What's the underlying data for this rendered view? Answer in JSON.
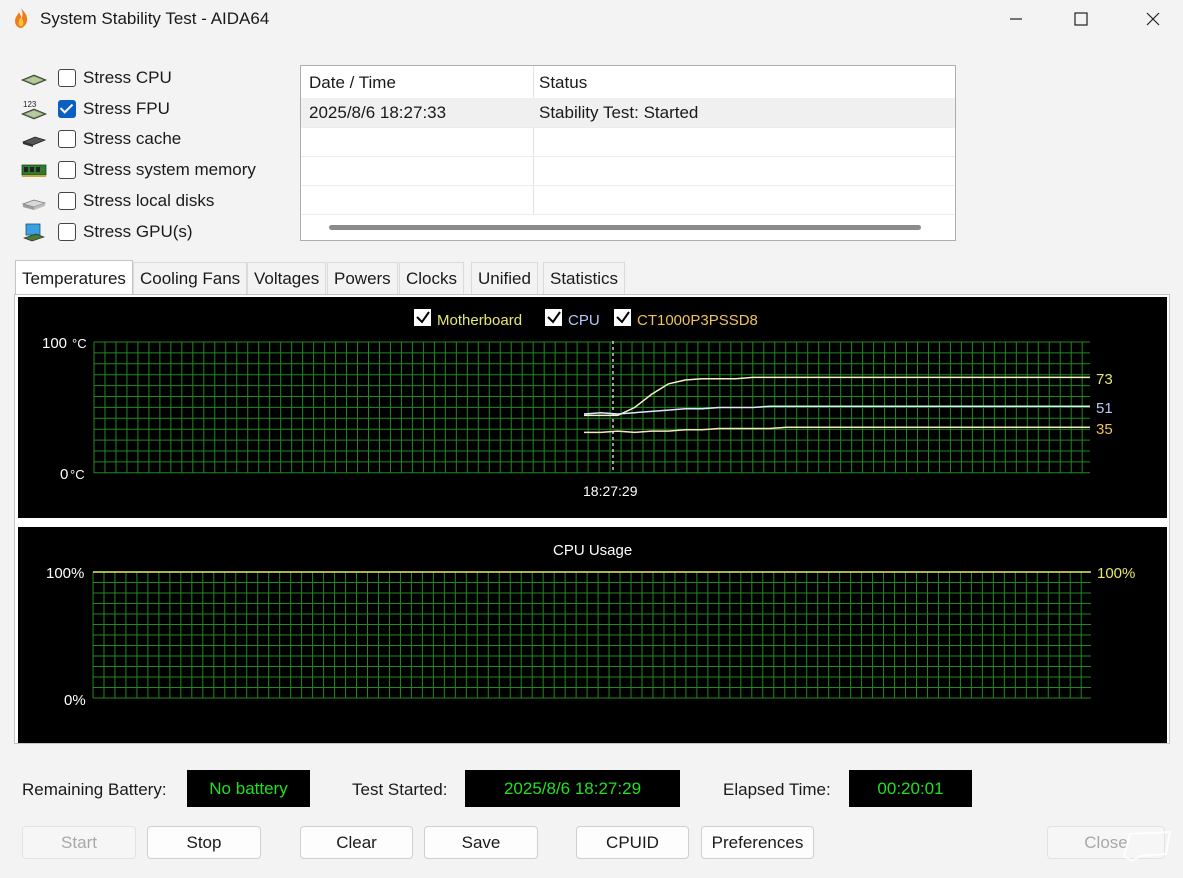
{
  "window": {
    "title": "System Stability Test - AIDA64"
  },
  "stress_options": [
    {
      "label": "Stress CPU",
      "checked": false,
      "icon": "cpu-chip-icon"
    },
    {
      "label": "Stress FPU",
      "checked": true,
      "icon": "fpu-123-icon"
    },
    {
      "label": "Stress cache",
      "checked": false,
      "icon": "cache-chip-icon"
    },
    {
      "label": "Stress system memory",
      "checked": false,
      "icon": "memory-module-icon"
    },
    {
      "label": "Stress local disks",
      "checked": false,
      "icon": "disk-drive-icon"
    },
    {
      "label": "Stress GPU(s)",
      "checked": false,
      "icon": "gpu-monitor-icon"
    }
  ],
  "log": {
    "headers": [
      "Date / Time",
      "Status"
    ],
    "rows": [
      [
        "2025/8/6 18:27:33",
        "Stability Test: Started"
      ]
    ]
  },
  "tabs": [
    "Temperatures",
    "Cooling Fans",
    "Voltages",
    "Powers",
    "Clocks",
    "Unified",
    "Statistics"
  ],
  "temp_graph": {
    "legend": [
      {
        "label": "Motherboard",
        "checked": true,
        "color": "#e8e870"
      },
      {
        "label": "CPU",
        "checked": true,
        "color": "#b8c8ff"
      },
      {
        "label": "CT1000P3PSSD8",
        "checked": true,
        "color": "#f0c060"
      }
    ],
    "y_top": "100",
    "y_bottom": "0",
    "unit": "°C",
    "time_label": "18:27:29",
    "current_values": [
      "73",
      "51",
      "35"
    ]
  },
  "cpu_graph": {
    "title": "CPU Usage",
    "y_top": "100%",
    "y_bottom": "0%",
    "current_value": "100%"
  },
  "chart_data": [
    {
      "type": "line",
      "ylim": [
        0,
        100
      ],
      "series": [
        {
          "name": "Motherboard",
          "values": [
            44,
            44,
            44,
            50,
            60,
            68,
            71,
            72,
            72,
            72,
            73,
            73,
            73,
            73,
            73,
            73,
            73,
            73,
            73,
            73,
            73,
            73,
            73,
            73,
            73,
            73,
            73,
            73,
            73,
            73,
            73
          ]
        },
        {
          "name": "CPU",
          "values": [
            45,
            46,
            45,
            46,
            47,
            48,
            49,
            49,
            50,
            50,
            50,
            51,
            51,
            51,
            51,
            51,
            51,
            51,
            51,
            51,
            51,
            51,
            51,
            51,
            51,
            51,
            51,
            51,
            51,
            51,
            51
          ]
        },
        {
          "name": "CT1000P3PSSD8",
          "values": [
            31,
            31,
            32,
            31,
            32,
            32,
            33,
            33,
            34,
            34,
            34,
            34,
            35,
            35,
            35,
            35,
            35,
            35,
            35,
            35,
            35,
            35,
            35,
            35,
            35,
            35,
            35,
            35,
            35,
            35,
            35
          ]
        }
      ]
    },
    {
      "type": "line",
      "ylim": [
        0,
        100
      ],
      "series": [
        {
          "name": "CPU Usage",
          "values": [
            100
          ]
        }
      ]
    }
  ],
  "status": {
    "battery_label": "Remaining Battery:",
    "battery_value": "No battery",
    "started_label": "Test Started:",
    "started_value": "2025/8/6 18:27:29",
    "elapsed_label": "Elapsed Time:",
    "elapsed_value": "00:20:01"
  },
  "buttons": {
    "start": "Start",
    "stop": "Stop",
    "clear": "Clear",
    "save": "Save",
    "cpuid": "CPUID",
    "preferences": "Preferences",
    "close": "Close"
  },
  "colors": {
    "grid": "#1f8a1f",
    "value_text": "#20e020",
    "checkbox_checked": "#0a5fc2"
  }
}
